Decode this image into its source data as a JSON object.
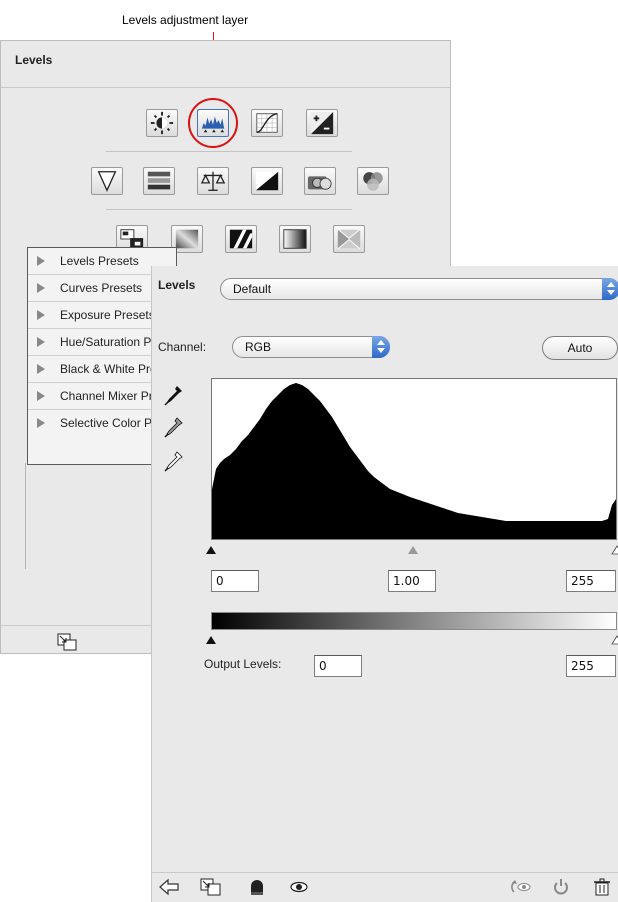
{
  "annotation": {
    "text": "Levels adjustment layer",
    "color": "#dd1111"
  },
  "adjustments_panel": {
    "title": "Levels",
    "row1_icons": [
      "brightness-contrast-icon",
      "levels-icon",
      "curves-icon",
      "exposure-icon"
    ],
    "row2_icons": [
      "vibrance-icon",
      "hue-saturation-icon",
      "color-balance-icon",
      "black-white-icon",
      "photo-filter-icon",
      "channel-mixer-icon"
    ],
    "row3_icons": [
      "invert-icon",
      "posterize-icon",
      "threshold-icon",
      "gradient-map-icon",
      "selective-color-icon"
    ],
    "presets": [
      "Levels Presets",
      "Curves Presets",
      "Exposure Presets",
      "Hue/Saturation Presets",
      "Black & White Presets",
      "Channel Mixer Presets",
      "Selective Color Presets"
    ],
    "footer_icon": "clip-to-layer-icon"
  },
  "levels_panel": {
    "label": "Levels",
    "preset_value": "Default",
    "channel_label": "Channel:",
    "channel_value": "RGB",
    "auto_label": "Auto",
    "eyedroppers": [
      "black-point-eyedropper-icon",
      "gray-point-eyedropper-icon",
      "white-point-eyedropper-icon"
    ],
    "input_black": "0",
    "input_gamma": "1.00",
    "input_white": "255",
    "output_label": "Output Levels:",
    "output_black": "0",
    "output_white": "255",
    "footer_icons": [
      "back-arrow-icon",
      "clip-to-layer-icon",
      "mask-icon",
      "visibility-eye-icon",
      "view-previous-icon",
      "reset-icon",
      "trash-icon"
    ],
    "accent": "#2d69c9"
  }
}
